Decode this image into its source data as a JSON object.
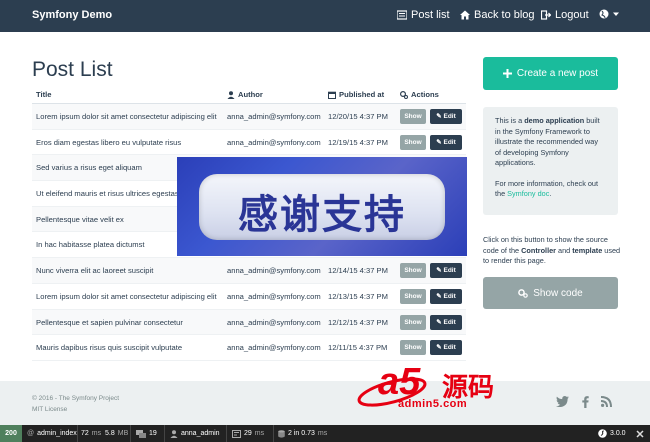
{
  "navbar": {
    "brand": "Symfony Demo",
    "links": [
      {
        "label": "Post list",
        "icon": "list-icon"
      },
      {
        "label": "Back to blog",
        "icon": "home-icon"
      },
      {
        "label": "Logout",
        "icon": "logout-icon"
      }
    ],
    "language_icon": "globe-icon"
  },
  "page": {
    "title": "Post List"
  },
  "table": {
    "headers": {
      "title": "Title",
      "author": "Author",
      "published": "Published at",
      "actions": "Actions"
    },
    "show_label": "Show",
    "edit_label": "Edit",
    "rows": [
      {
        "title": "Lorem ipsum dolor sit amet consectetur adipiscing elit",
        "author": "anna_admin@symfony.com",
        "date": "12/20/15 4:37 PM"
      },
      {
        "title": "Eros diam egestas libero eu vulputate risus",
        "author": "anna_admin@symfony.com",
        "date": "12/19/15 4:37 PM"
      },
      {
        "title": "Sed varius a risus eget aliquam",
        "author": "",
        "date": ""
      },
      {
        "title": "Ut eleifend mauris et risus ultrices egestas",
        "author": "",
        "date": ""
      },
      {
        "title": "Pellentesque vitae velit ex",
        "author": "",
        "date": ""
      },
      {
        "title": "In hac habitasse platea dictumst",
        "author": "",
        "date": ""
      },
      {
        "title": "Nunc viverra elit ac laoreet suscipit",
        "author": "anna_admin@symfony.com",
        "date": "12/14/15 4:37 PM"
      },
      {
        "title": "Lorem ipsum dolor sit amet consectetur adipiscing elit",
        "author": "anna_admin@symfony.com",
        "date": "12/13/15 4:37 PM"
      },
      {
        "title": "Pellentesque et sapien pulvinar consectetur",
        "author": "anna_admin@symfony.com",
        "date": "12/12/15 4:37 PM"
      },
      {
        "title": "Mauris dapibus risus quis suscipit vulputate",
        "author": "anna_admin@symfony.com",
        "date": "12/11/15 4:37 PM"
      }
    ]
  },
  "sidebar": {
    "create_label": "Create a new post",
    "info_p1_pre": "This is a ",
    "info_p1_bold": "demo application",
    "info_p1_post": " built in the Symfony Framework to illustrate the recommended way of developing Symfony applications.",
    "info_p2_pre": "For more information, check out the ",
    "info_p2_link": "Symfony doc",
    "info_p2_post": ".",
    "source_pre": "Click on this button to show the source code of the ",
    "source_b1": "Controller",
    "source_mid": " and ",
    "source_b2": "template",
    "source_post": " used to render this page.",
    "show_code_label": "Show code"
  },
  "footer": {
    "copyright": "© 2016 - The Symfony Project",
    "license": "MIT License"
  },
  "toolbar": {
    "status": "200",
    "route": "admin_index",
    "time": "72",
    "time_unit": "ms",
    "memory": "5.8",
    "memory_unit": "MB",
    "logs": "19",
    "user": "anna_admin",
    "twig_time": "29",
    "twig_unit": "ms",
    "db": "2 in 0.73",
    "db_unit": "ms",
    "version": "3.0.0"
  },
  "overlay": {
    "banner_text": "感谢支持",
    "logo_a5": "a5",
    "logo_cn": "源码",
    "logo_url": "admin5.com"
  },
  "colors": {
    "navbar": "#2c3e50",
    "accent": "#1abc9c",
    "muted_button": "#95a5a6",
    "footer_bg": "#ecf0f1",
    "toolbar_bg": "#222222",
    "status_ok": "#4f805d"
  }
}
